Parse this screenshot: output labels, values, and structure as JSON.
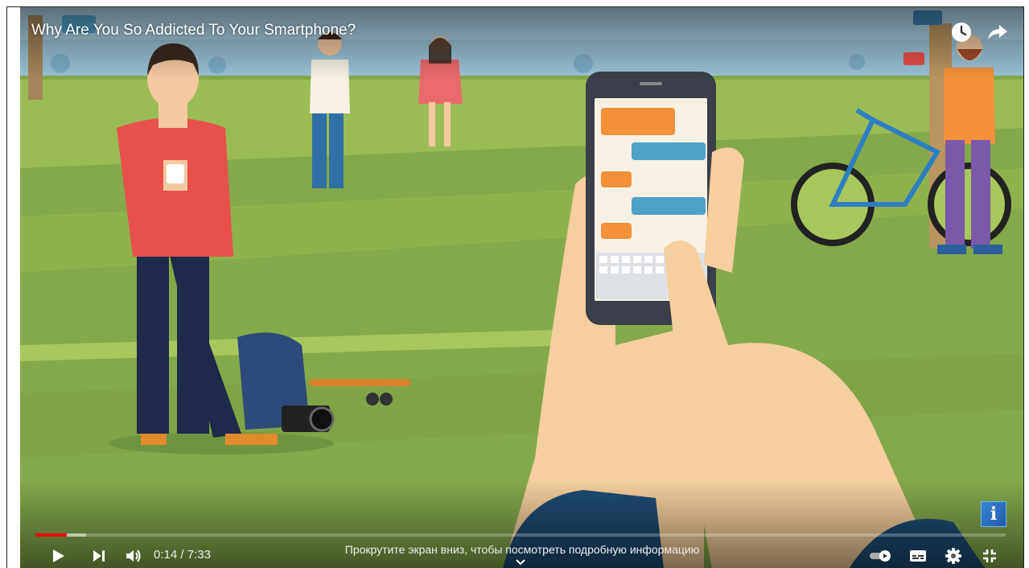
{
  "video": {
    "title": "Why Are You So Addicted To Your Smartphone?",
    "time_current": "0:14",
    "time_separator": " / ",
    "time_total": "7:33",
    "progress_played_fraction": 0.032,
    "progress_buffered_fraction": 0.052,
    "scroll_hint": "Прокрутите экран вниз, чтобы посмотреть подробную информацию"
  },
  "icons": {
    "watch_later": "clock-icon",
    "share": "share-arrow-icon",
    "play": "play-icon",
    "next": "skip-next-icon",
    "volume": "volume-icon",
    "autoplay": "autoplay-toggle-icon",
    "subtitles": "subtitles-icon",
    "settings": "gear-icon",
    "exit_fullscreen": "exit-fullscreen-icon",
    "scroll_down": "chevron-down-icon",
    "info_card": "info-card-icon"
  },
  "info_card": {
    "label": "i"
  },
  "colors": {
    "progress_played": "#ff0000",
    "grass": "#84a94a",
    "sky": "#a9cde0"
  }
}
